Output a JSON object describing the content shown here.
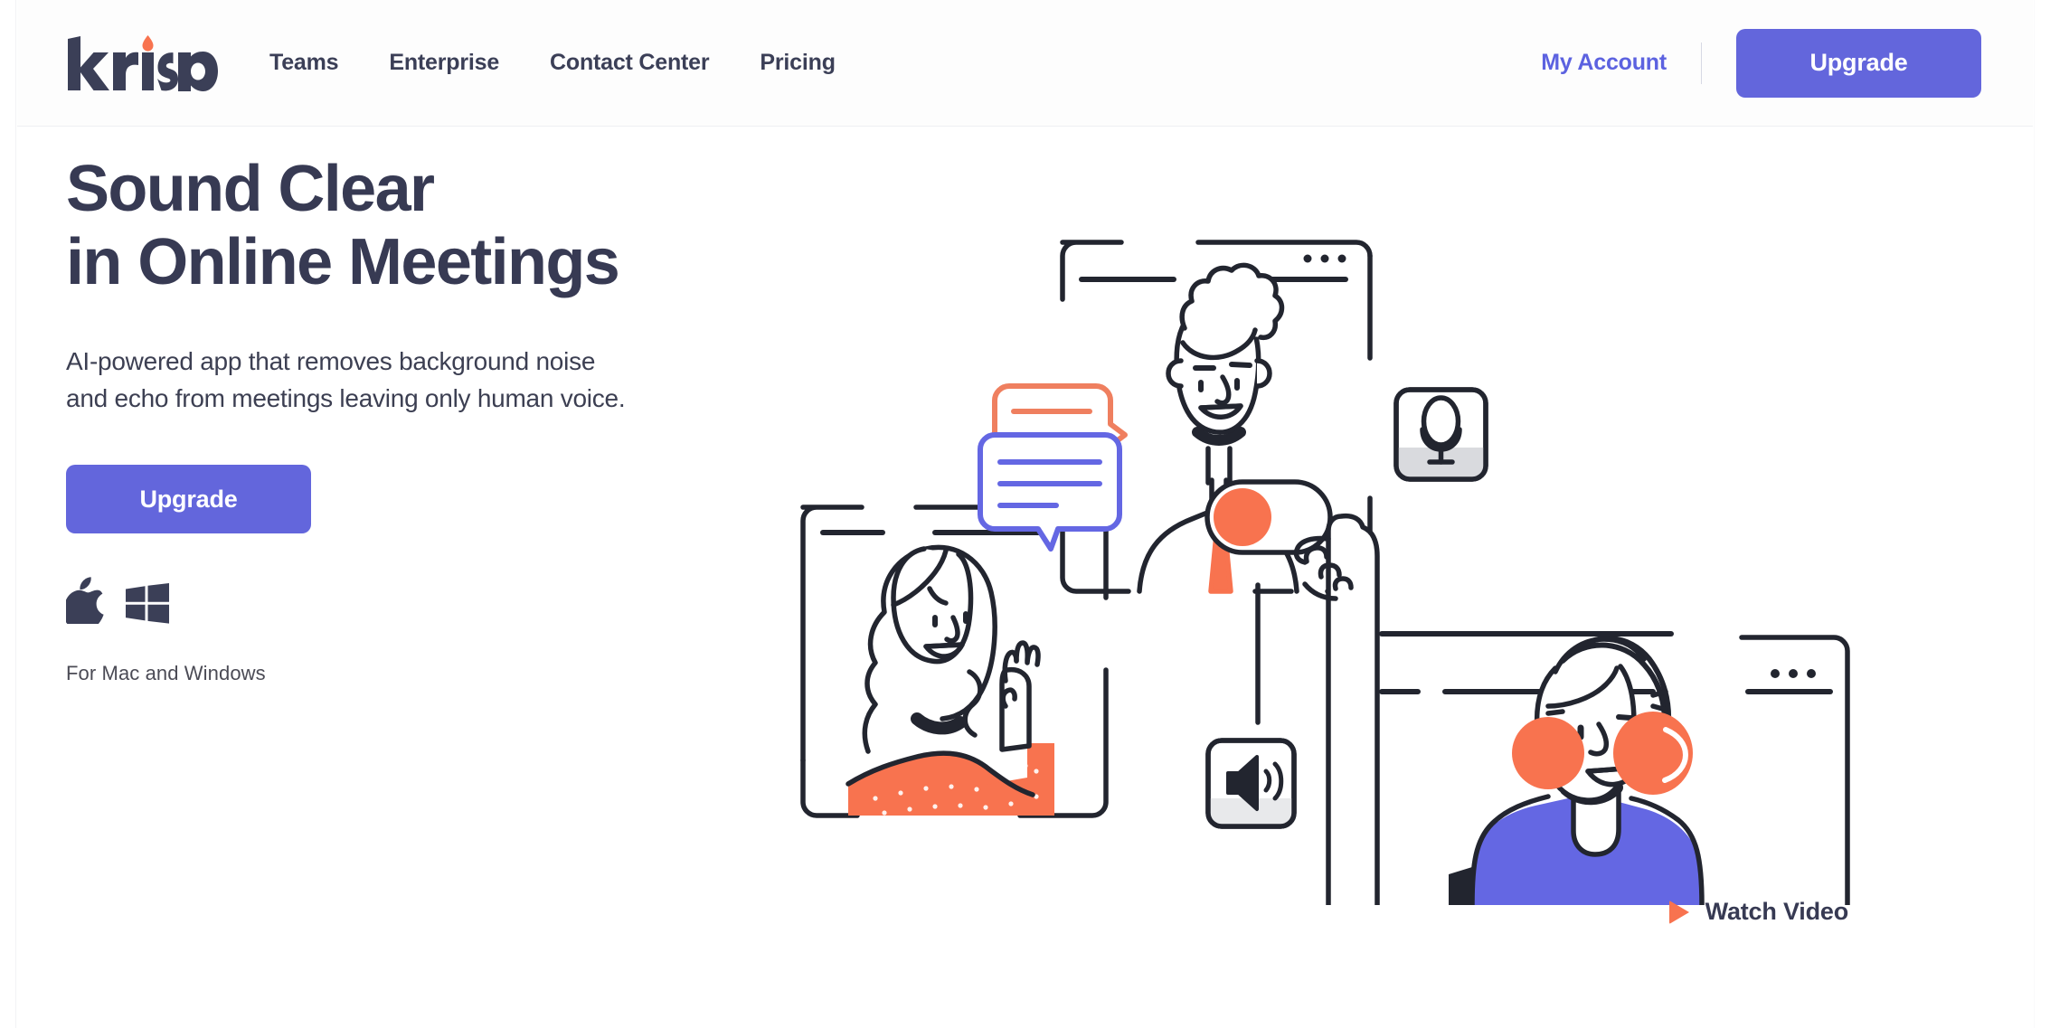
{
  "brand": {
    "name": "krisp",
    "wordmark_color": "#3b3f57",
    "accent_dot_color": "#f8734f"
  },
  "colors": {
    "purple": "#6366dc",
    "orange": "#f8734f",
    "ink": "#373a53",
    "line": "#22252f",
    "body_text": "#3c3f52"
  },
  "header": {
    "nav": [
      {
        "label": "Teams"
      },
      {
        "label": "Enterprise"
      },
      {
        "label": "Contact Center"
      },
      {
        "label": "Pricing"
      }
    ],
    "account_label": "My Account",
    "upgrade_label": "Upgrade"
  },
  "hero": {
    "title_line_1": "Sound Clear",
    "title_line_2": "in Online Meetings",
    "subtitle_line_1": "AI-powered app that removes background noise",
    "subtitle_line_2": "and echo from meetings leaving only human voice.",
    "cta_label": "Upgrade",
    "os_icons": [
      "apple-icon",
      "windows-icon"
    ],
    "platform_note": "For Mac and Windows",
    "watch_video_label": "Watch Video"
  },
  "illustration": {
    "description": "Three people in video-call windows with chat bubbles, microphone toggle, speaker icon and noise-cancel switch",
    "elements": [
      "video-window-top",
      "chat-bubble-orange",
      "microphone-tile",
      "video-window-left",
      "chat-bubble-purple",
      "noise-toggle-switch",
      "speaker-tile",
      "pointing-hand",
      "video-window-right"
    ]
  }
}
